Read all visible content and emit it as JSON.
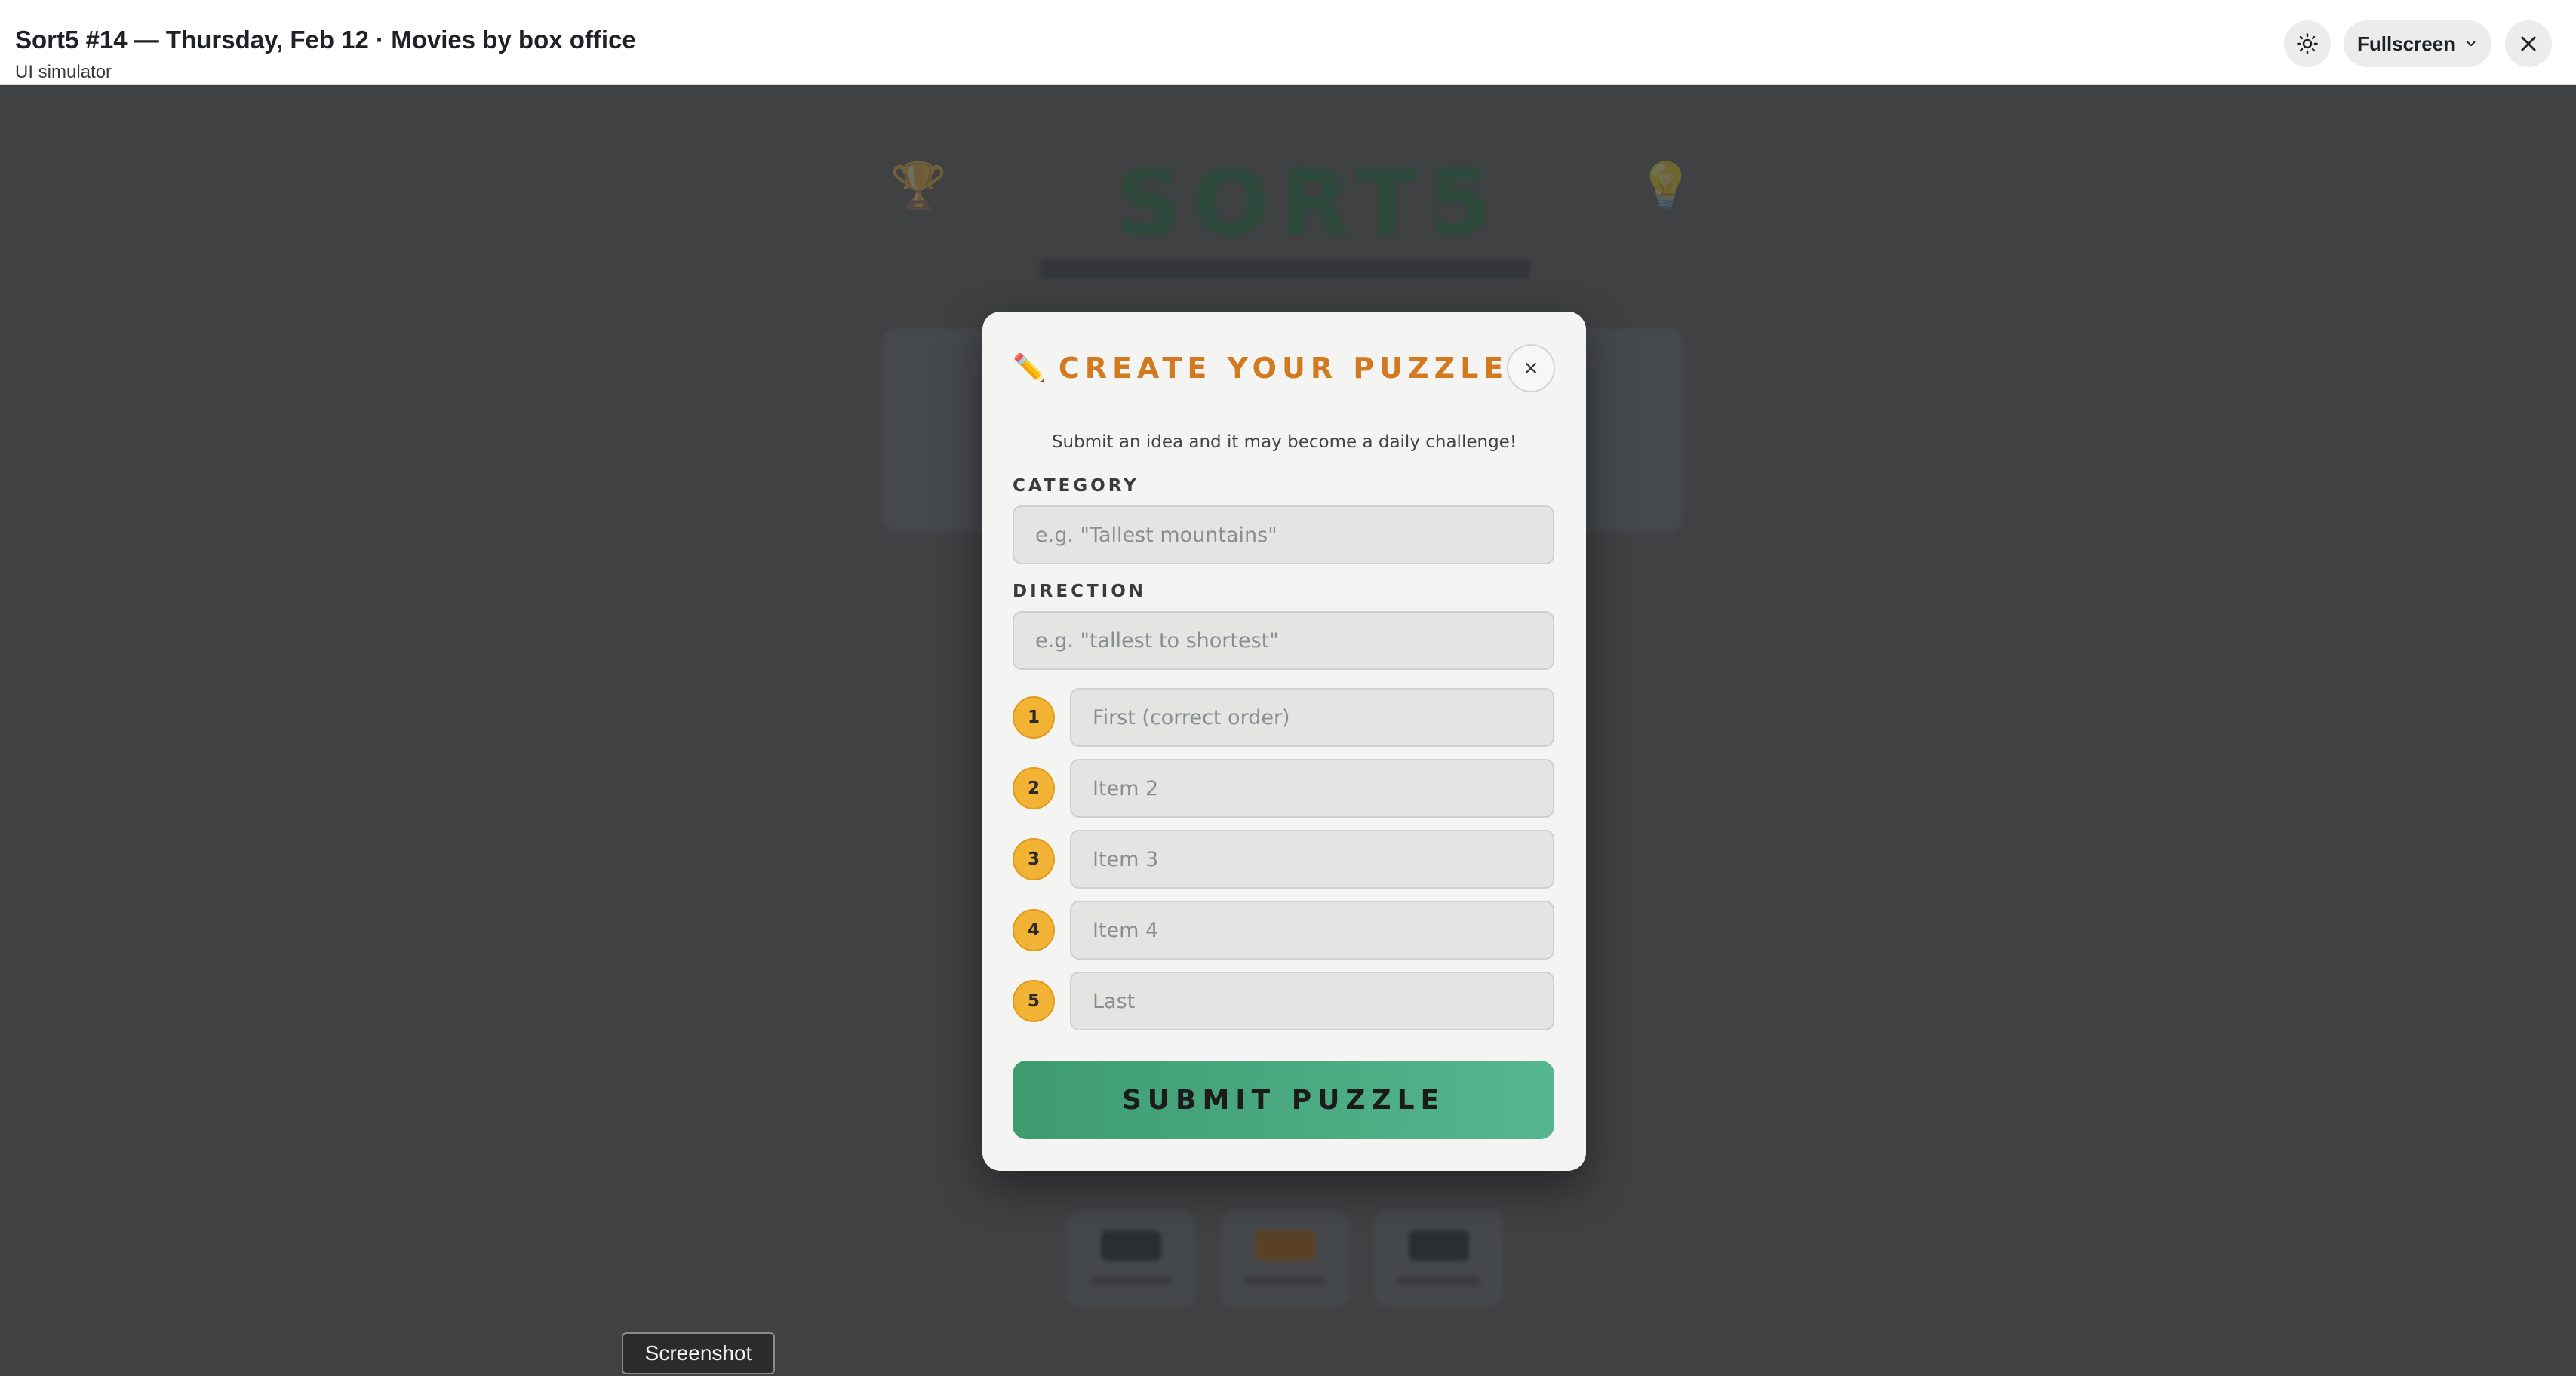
{
  "topbar": {
    "title": "Sort5 #14 — Thursday, Feb 12 · Movies by box office",
    "subtitle": "UI simulator",
    "theme_icon": "sun-icon",
    "fullscreen_label": "Fullscreen",
    "close_icon": "close-icon"
  },
  "background": {
    "logo_text": "SORT5",
    "stat_count": 3
  },
  "modal": {
    "title_icon": "✏️",
    "title": "CREATE YOUR PUZZLE",
    "close_label": "×",
    "intro": "Submit an idea and it may become a daily challenge!",
    "category": {
      "label": "CATEGORY",
      "placeholder": "e.g. \"Tallest mountains\"",
      "value": ""
    },
    "direction": {
      "label": "DIRECTION",
      "placeholder": "e.g. \"tallest to shortest\"",
      "value": ""
    },
    "items": [
      {
        "number": "1",
        "placeholder": "First (correct order)",
        "value": ""
      },
      {
        "number": "2",
        "placeholder": "Item 2",
        "value": ""
      },
      {
        "number": "3",
        "placeholder": "Item 3",
        "value": ""
      },
      {
        "number": "4",
        "placeholder": "Item 4",
        "value": ""
      },
      {
        "number": "5",
        "placeholder": "Last",
        "value": ""
      }
    ],
    "submit_label": "SUBMIT PUZZLE"
  },
  "colors": {
    "accent_orange": "#d27a1f",
    "badge_yellow": "#f2b233",
    "submit_green": "#3e9b70"
  },
  "screenshot_tag": "Screenshot"
}
